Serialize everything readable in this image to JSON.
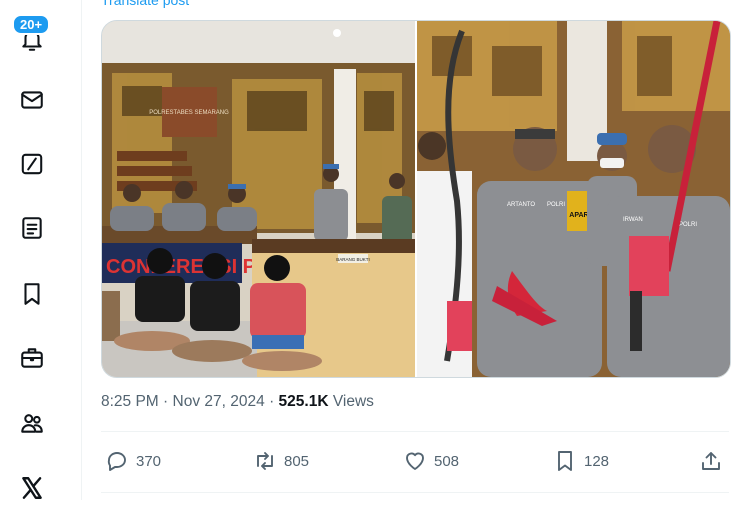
{
  "nav": {
    "notifications_badge": "20+",
    "items": [
      "notifications-icon",
      "messages-icon",
      "grok-icon",
      "lists-icon",
      "bookmarks-icon",
      "jobs-icon",
      "communities-icon",
      "x-logo-icon"
    ]
  },
  "tweet": {
    "translate_label": "Translate post",
    "time": "8:25 PM",
    "separator": "·",
    "date": "Nov 27, 2024",
    "views_count": "525.1K",
    "views_label": "Views",
    "media": {
      "left_photo": {
        "wall_sign": "POLRESTABES SEMARANG",
        "banner_text": "CONFERENSI PERS",
        "desk_sign": "BARANG BUKTI"
      },
      "right_photo": {
        "officer1_name": "ARTANTO",
        "officer1_tag": "POLRI",
        "officer2_name": "IRWAN",
        "officer2_tag": "POLRI",
        "patch_text": "APARAN"
      }
    }
  },
  "actions": {
    "replies": "370",
    "reposts": "805",
    "likes": "508",
    "bookmarks": "128"
  },
  "colors": {
    "accent": "#1d9bf0",
    "muted": "#536471",
    "text": "#0f1419"
  }
}
